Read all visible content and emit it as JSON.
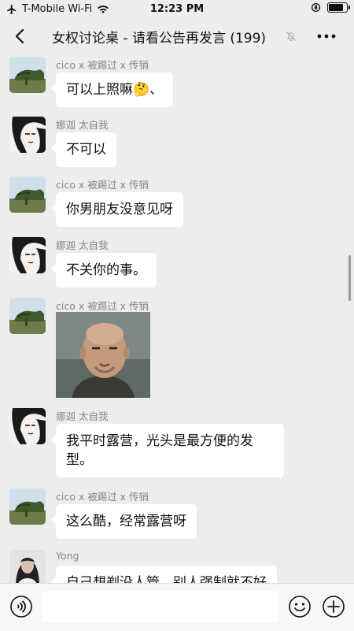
{
  "status_bar": {
    "carrier": "T-Mobile Wi-Fi",
    "time": "12:23 PM",
    "battery_level": 0.9
  },
  "nav": {
    "title": "女权讨论桌 - 请看公告再发言 (199)",
    "back_icon": "chevron-left-icon",
    "mute_icon": "bell-slash-icon",
    "more_icon": "ellipsis-icon"
  },
  "messages": [
    {
      "sender": "cico x 被踢过 x 传销",
      "text": "可以上照嘛🤔、",
      "avatar": "landscape-tree-avatar"
    },
    {
      "sender": "娜迦 太自我",
      "text": "不可以",
      "avatar": "manga-figure-avatar"
    },
    {
      "sender": "cico x 被踢过 x 传销",
      "text": "你男朋友没意见呀",
      "avatar": "landscape-tree-avatar"
    },
    {
      "sender": "娜迦 太自我",
      "text": "不关你的事。",
      "avatar": "manga-figure-avatar"
    },
    {
      "sender": "cico x 被踢过 x 传销",
      "text": "",
      "avatar": "landscape-tree-avatar",
      "image": "bald-man-photo"
    },
    {
      "sender": "娜迦 太自我",
      "text_line1": "我平时露营，光头是最方便的发",
      "text_line2": "型。",
      "avatar": "manga-figure-avatar"
    },
    {
      "sender": "cico x 被踢过 x 传销",
      "text": "这么酷，经常露营呀",
      "avatar": "landscape-tree-avatar"
    },
    {
      "sender": "Yong",
      "text": "自己想剃没人管，别人强制就不好",
      "avatar": "portrait-woman-avatar"
    }
  ],
  "input": {
    "value": "",
    "voice_icon": "voice-icon",
    "emoji_icon": "smiley-icon",
    "plus_icon": "plus-icon"
  },
  "colors": {
    "background": "#ededed",
    "bubble": "#ffffff",
    "sender_text": "#888888"
  }
}
